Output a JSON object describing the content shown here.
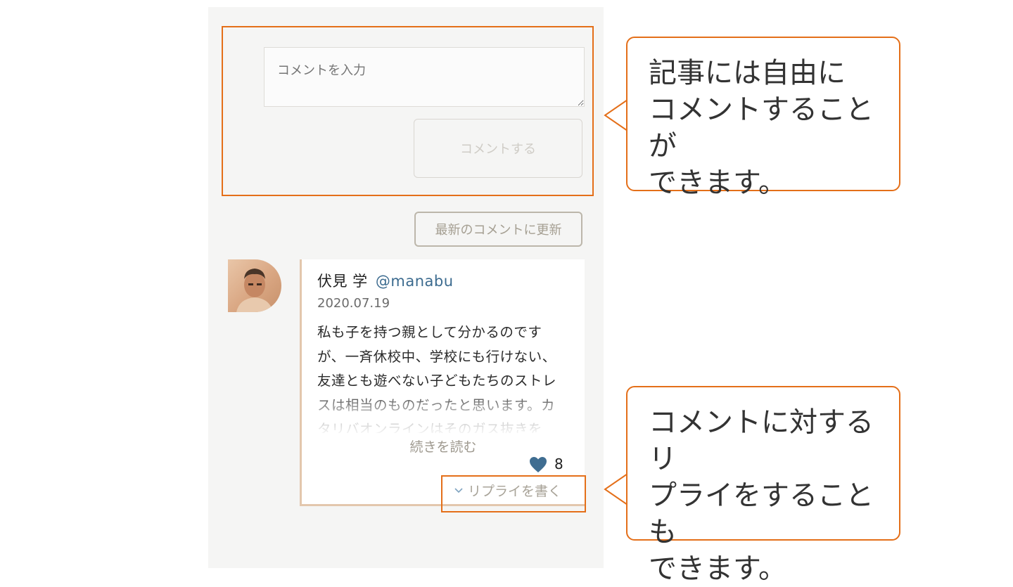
{
  "comment_form": {
    "input_placeholder": "コメントを入力",
    "submit_label": "コメントする"
  },
  "refresh_label": "最新のコメントに更新",
  "comment": {
    "author_name": "伏見 学",
    "author_handle": "@manabu",
    "date": "2020.07.19",
    "body": "私も子を持つ親として分かるのですが、一斉休校中、学校にも行けない、友達とも遊べない子どもたちのストレスは相当のものだったと思います。カタリバオンラインはそのガス抜きを",
    "read_more": "続きを読む",
    "like_count": "8",
    "reply_label": "リプライを書く"
  },
  "callouts": {
    "top": "記事には自由に\nコメントすることが\nできます。",
    "bottom": "コメントに対するリ\nプライをすることも\nできます。"
  },
  "colors": {
    "highlight": "#e46f19",
    "handle": "#3c6b8f",
    "heart": "#3f6d91"
  },
  "icons": {
    "like": "heart-icon",
    "reply": "chevron-down-icon"
  }
}
